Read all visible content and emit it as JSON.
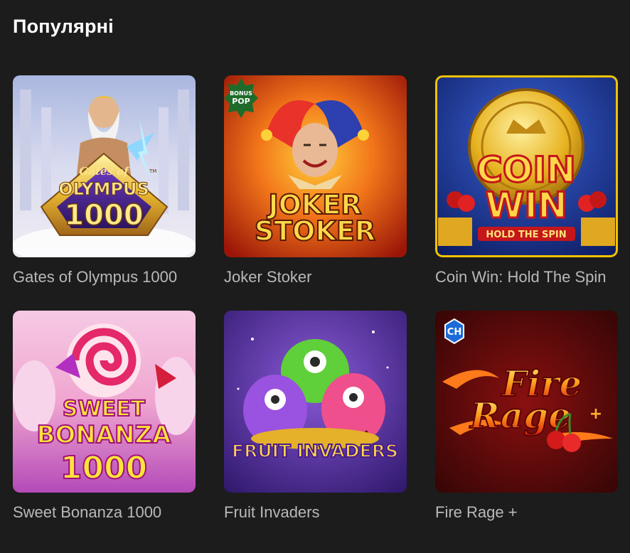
{
  "section": {
    "title": "Популярні"
  },
  "games": [
    {
      "title": "Gates of Olympus 1000",
      "art_text_1": "Gates of",
      "art_text_2": "OLYMPUS",
      "art_text_3": "1000",
      "art_tm": "TM",
      "icon": "zeus-icon"
    },
    {
      "title": "Joker Stoker",
      "art_text_1": "JOKER",
      "art_text_2": "STOKER",
      "badge_1": "BONUS",
      "badge_2": "POP",
      "icon": "jester-icon"
    },
    {
      "title": "Coin Win: Hold The Spin",
      "art_text_1": "COIN",
      "art_text_2": "WIN",
      "art_text_3": "HOLD THE SPIN",
      "icon": "gold-coin-icon"
    },
    {
      "title": "Sweet Bonanza 1000",
      "art_text_1": "SWEET",
      "art_text_2": "BONANZA",
      "art_text_3": "1000",
      "icon": "lollipop-icon"
    },
    {
      "title": "Fruit Invaders",
      "art_text_1": "FRUIT INVADERS",
      "icon": "monster-icon"
    },
    {
      "title": "Fire Rage +",
      "art_text_1": "Fire",
      "art_text_2": "Rage",
      "art_text_3": "+",
      "badge_1": "CH",
      "icon": "cherry-icon"
    }
  ],
  "colors": {
    "background": "#1c1c1c",
    "title_text": "#ffffff",
    "game_title_text": "#b9b9b9",
    "coin_win_border": "#f2c200"
  }
}
